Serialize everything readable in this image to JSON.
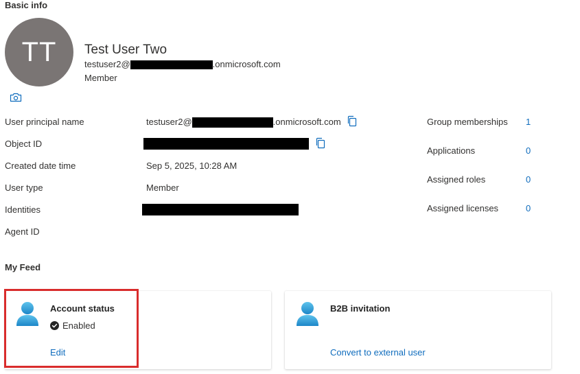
{
  "basic_info": {
    "heading": "Basic info",
    "avatar_initials": "TT",
    "name": "Test User Two",
    "email_prefix": "testuser2@",
    "email_suffix": ".onmicrosoft.com",
    "user_type_caption": "Member"
  },
  "properties": {
    "upn_label": "User principal name",
    "upn_prefix": "testuser2@",
    "upn_suffix": ".onmicrosoft.com",
    "object_id_label": "Object ID",
    "created_label": "Created date time",
    "created_value": "Sep 5, 2025, 10:28 AM",
    "user_type_label": "User type",
    "user_type_value": "Member",
    "identities_label": "Identities",
    "agent_id_label": "Agent ID"
  },
  "stats": {
    "group_memberships_label": "Group memberships",
    "group_memberships_value": "1",
    "applications_label": "Applications",
    "applications_value": "0",
    "assigned_roles_label": "Assigned roles",
    "assigned_roles_value": "0",
    "assigned_licenses_label": "Assigned licenses",
    "assigned_licenses_value": "0"
  },
  "feed": {
    "heading": "My Feed",
    "account_status": {
      "title": "Account status",
      "status": "Enabled",
      "action": "Edit"
    },
    "b2b": {
      "title": "B2B invitation",
      "action": "Convert to external user"
    }
  },
  "colors": {
    "accent": "#0f6cbd",
    "avatar_bg": "#7a7574",
    "highlight_border": "#d92c2c"
  },
  "icons": [
    "camera-icon",
    "copy-icon",
    "user-icon",
    "check-circle-icon"
  ]
}
